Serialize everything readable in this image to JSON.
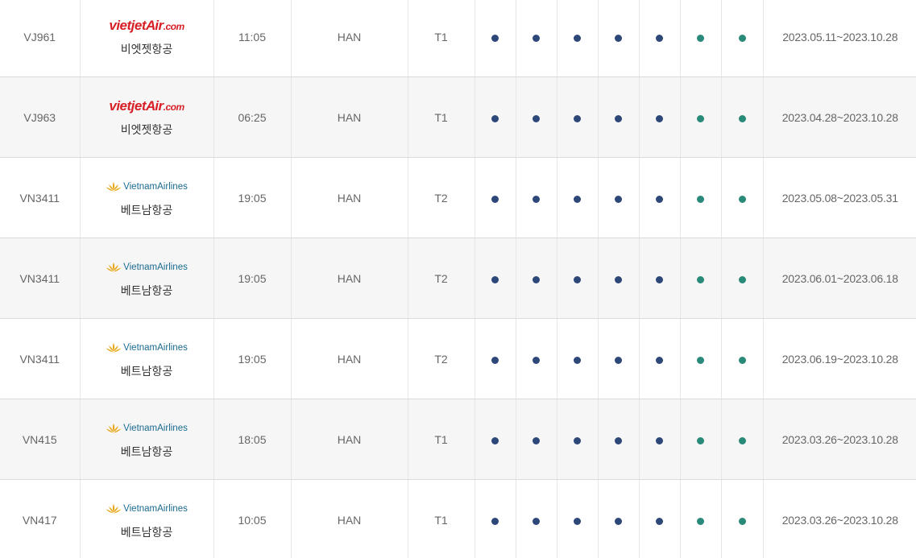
{
  "colors": {
    "weekday_dot": "#2e4779",
    "weekend_dot": "#2a8a7a"
  },
  "rows": [
    {
      "flight": "VJ961",
      "logo": "vietjet",
      "logo_text": "vietjetAir.com",
      "airline": "비엣젯항공",
      "time": "11:05",
      "airport": "HAN",
      "terminal": "T1",
      "period": "2023.05.11~2023.10.28"
    },
    {
      "flight": "VJ963",
      "logo": "vietjet",
      "logo_text": "vietjetAir.com",
      "airline": "비엣젯항공",
      "time": "06:25",
      "airport": "HAN",
      "terminal": "T1",
      "period": "2023.04.28~2023.10.28"
    },
    {
      "flight": "VN3411",
      "logo": "vietnam",
      "logo_text": "VietnamAirlines",
      "airline": "베트남항공",
      "time": "19:05",
      "airport": "HAN",
      "terminal": "T2",
      "period": "2023.05.08~2023.05.31"
    },
    {
      "flight": "VN3411",
      "logo": "vietnam",
      "logo_text": "VietnamAirlines",
      "airline": "베트남항공",
      "time": "19:05",
      "airport": "HAN",
      "terminal": "T2",
      "period": "2023.06.01~2023.06.18"
    },
    {
      "flight": "VN3411",
      "logo": "vietnam",
      "logo_text": "VietnamAirlines",
      "airline": "베트남항공",
      "time": "19:05",
      "airport": "HAN",
      "terminal": "T2",
      "period": "2023.06.19~2023.10.28"
    },
    {
      "flight": "VN415",
      "logo": "vietnam",
      "logo_text": "VietnamAirlines",
      "airline": "베트남항공",
      "time": "18:05",
      "airport": "HAN",
      "terminal": "T1",
      "period": "2023.03.26~2023.10.28"
    },
    {
      "flight": "VN417",
      "logo": "vietnam",
      "logo_text": "VietnamAirlines",
      "airline": "베트남항공",
      "time": "10:05",
      "airport": "HAN",
      "terminal": "T1",
      "period": "2023.03.26~2023.10.28"
    }
  ],
  "days_operating": [
    "weekday",
    "weekday",
    "weekday",
    "weekday",
    "weekday",
    "weekend",
    "weekend"
  ]
}
